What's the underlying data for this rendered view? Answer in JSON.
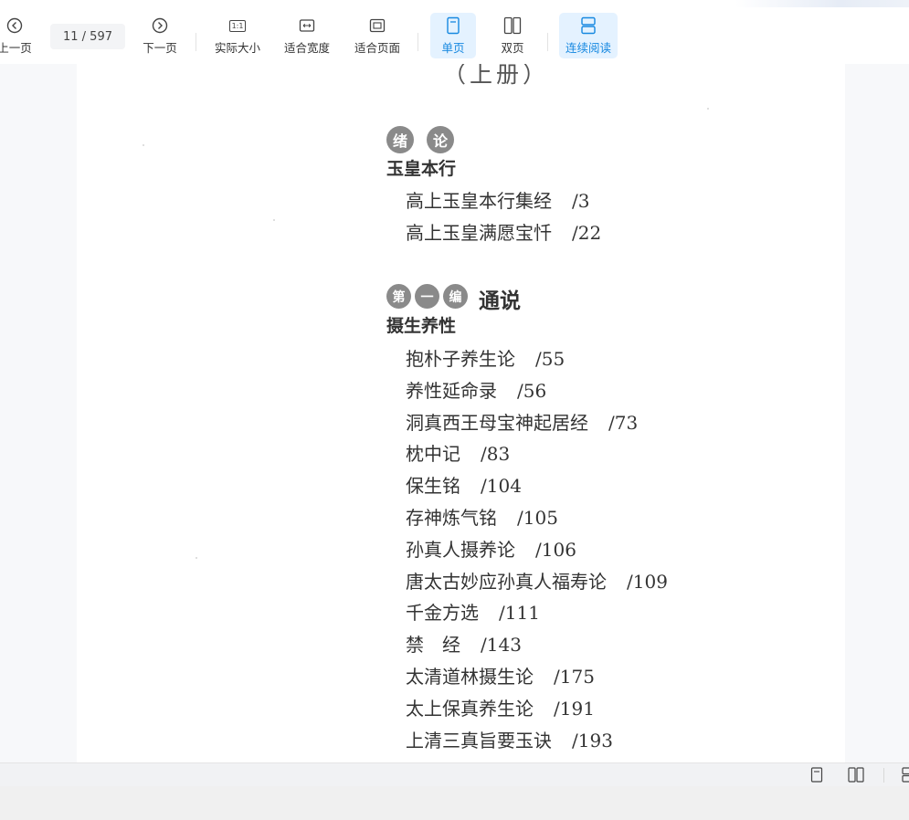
{
  "toolbar": {
    "prev_label": "上一页",
    "page_indicator": "11 / 597",
    "next_label": "下一页",
    "actual_size_label": "实际大小",
    "actual_size_icon_text": "1:1",
    "fit_width_label": "适合宽度",
    "fit_page_label": "适合页面",
    "single_page_label": "单页",
    "double_page_label": "双页",
    "continuous_label": "连续阅读"
  },
  "colors": {
    "accent": "#1688e0",
    "active_bg": "#e4f2ff"
  },
  "icons": {
    "prev": "circle-chevron-left-icon",
    "next": "circle-chevron-right-icon",
    "actual_size": "one-to-one-icon",
    "fit_width": "fit-width-icon",
    "fit_page": "fit-page-icon",
    "single": "single-page-icon",
    "double": "double-page-icon",
    "continuous": "continuous-scroll-icon"
  },
  "document": {
    "volume_heading": "（上册）",
    "intro": {
      "badges": [
        "绪",
        "论"
      ],
      "subsection": "玉皇本行",
      "entries": [
        {
          "title": "高上玉皇本行集经",
          "page": "/3"
        },
        {
          "title": "高上玉皇满愿宝忏",
          "page": "/22"
        }
      ]
    },
    "part1": {
      "badges": [
        "第",
        "一",
        "编"
      ],
      "title": "通说",
      "subsection": "摄生养性",
      "entries": [
        {
          "title": "抱朴子养生论",
          "page": "/55"
        },
        {
          "title": "养性延命录",
          "page": "/56"
        },
        {
          "title": "洞真西王母宝神起居经",
          "page": "/73"
        },
        {
          "title": "枕中记",
          "page": "/83"
        },
        {
          "title": "保生铭",
          "page": "/104"
        },
        {
          "title": "存神炼气铭",
          "page": "/105"
        },
        {
          "title": "孙真人摄养论",
          "page": "/106"
        },
        {
          "title": "唐太古妙应孙真人福寿论",
          "page": "/109"
        },
        {
          "title": "千金方选",
          "page": "/111"
        },
        {
          "title": "禁　经",
          "page": "/143"
        },
        {
          "title": "太清道林摄生论",
          "page": "/175"
        },
        {
          "title": "太上保真养生论",
          "page": "/191"
        },
        {
          "title": "上清三真旨要玉诀",
          "page": "/193"
        }
      ]
    }
  },
  "statusbar": {
    "icons": [
      "single-page-icon",
      "double-page-icon",
      "continuous-scroll-icon"
    ]
  }
}
